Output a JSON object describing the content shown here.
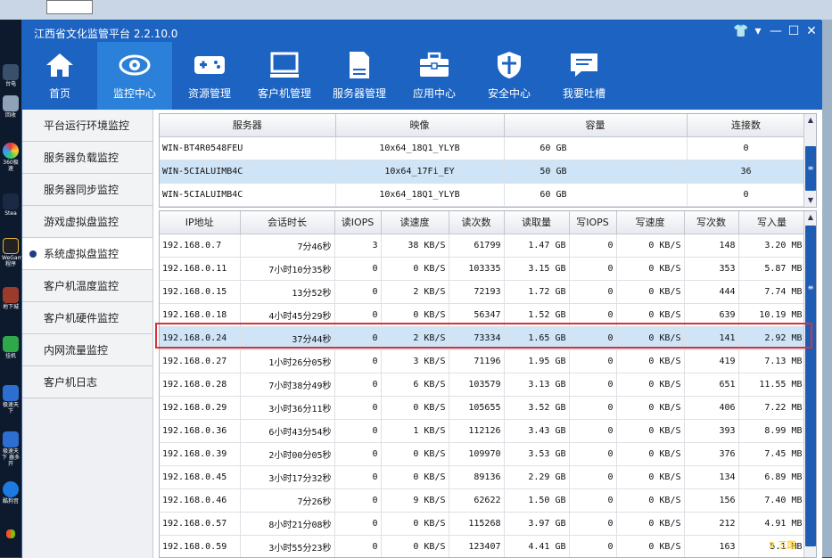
{
  "app": {
    "title": "江西省文化监管平台 2.2.10.0",
    "controls": [
      "shirt-icon",
      "menu-icon",
      "minimize-icon",
      "maximize-icon",
      "close-icon"
    ]
  },
  "nav": [
    {
      "label": "首页",
      "icon": "home-icon",
      "active": false
    },
    {
      "label": "监控中心",
      "icon": "eye-icon",
      "active": true
    },
    {
      "label": "资源管理",
      "icon": "gamepad-icon",
      "active": false
    },
    {
      "label": "客户机管理",
      "icon": "monitor-icon",
      "active": false
    },
    {
      "label": "服务器管理",
      "icon": "server-icon",
      "active": false
    },
    {
      "label": "应用中心",
      "icon": "toolbox-icon",
      "active": false
    },
    {
      "label": "安全中心",
      "icon": "shield-icon",
      "active": false
    },
    {
      "label": "我要吐槽",
      "icon": "chat-icon",
      "active": false
    }
  ],
  "sidebar": [
    {
      "label": "平台运行环境监控",
      "active": false
    },
    {
      "label": "服务器负载监控",
      "active": false
    },
    {
      "label": "服务器同步监控",
      "active": false
    },
    {
      "label": "游戏虚拟盘监控",
      "active": false
    },
    {
      "label": "系统虚拟盘监控",
      "active": true
    },
    {
      "label": "客户机温度监控",
      "active": false
    },
    {
      "label": "客户机硬件监控",
      "active": false
    },
    {
      "label": "内网流量监控",
      "active": false
    },
    {
      "label": "客户机日志",
      "active": false
    }
  ],
  "servers": {
    "headers": [
      "服务器",
      "映像",
      "容量",
      "连接数"
    ],
    "rows": [
      [
        "WIN-BT4R0548FEU",
        "10x64_18Q1_YLYB",
        "60 GB",
        "0"
      ],
      [
        "WIN-5CIALUIMB4C",
        "10x64_17Fi_EY",
        "50 GB",
        "36"
      ],
      [
        "WIN-5CIALUIMB4C",
        "10x64_18Q1_YLYB",
        "60 GB",
        "0"
      ]
    ],
    "selected_row": 1
  },
  "clients": {
    "headers": [
      "IP地址",
      "会话时长",
      "读IOPS",
      "读速度",
      "读次数",
      "读取量",
      "写IOPS",
      "写速度",
      "写次数",
      "写入量"
    ],
    "rows": [
      [
        "192.168.0.7",
        "7分46秒",
        "3",
        "38 KB/S",
        "61799",
        "1.47 GB",
        "0",
        "0 KB/S",
        "148",
        "3.20 MB"
      ],
      [
        "192.168.0.11",
        "7小时10分35秒",
        "0",
        "0 KB/S",
        "103335",
        "3.15 GB",
        "0",
        "0 KB/S",
        "353",
        "5.87 MB"
      ],
      [
        "192.168.0.15",
        "13分52秒",
        "0",
        "2 KB/S",
        "72193",
        "1.72 GB",
        "0",
        "0 KB/S",
        "444",
        "7.74 MB"
      ],
      [
        "192.168.0.18",
        "4小时45分29秒",
        "0",
        "0 KB/S",
        "56347",
        "1.52 GB",
        "0",
        "0 KB/S",
        "639",
        "10.19 MB"
      ],
      [
        "192.168.0.24",
        "37分44秒",
        "0",
        "2 KB/S",
        "73334",
        "1.65 GB",
        "0",
        "0 KB/S",
        "141",
        "2.92 MB"
      ],
      [
        "192.168.0.27",
        "1小时26分05秒",
        "0",
        "3 KB/S",
        "71196",
        "1.95 GB",
        "0",
        "0 KB/S",
        "419",
        "7.13 MB"
      ],
      [
        "192.168.0.28",
        "7小时38分49秒",
        "0",
        "6 KB/S",
        "103579",
        "3.13 GB",
        "0",
        "0 KB/S",
        "651",
        "11.55 MB"
      ],
      [
        "192.168.0.29",
        "3小时36分11秒",
        "0",
        "0 KB/S",
        "105655",
        "3.52 GB",
        "0",
        "0 KB/S",
        "406",
        "7.22 MB"
      ],
      [
        "192.168.0.36",
        "6小时43分54秒",
        "0",
        "1 KB/S",
        "112126",
        "3.43 GB",
        "0",
        "0 KB/S",
        "393",
        "8.99 MB"
      ],
      [
        "192.168.0.39",
        "2小时00分05秒",
        "0",
        "0 KB/S",
        "109970",
        "3.53 GB",
        "0",
        "0 KB/S",
        "376",
        "7.45 MB"
      ],
      [
        "192.168.0.45",
        "3小时17分32秒",
        "0",
        "0 KB/S",
        "89136",
        "2.29 GB",
        "0",
        "0 KB/S",
        "134",
        "6.89 MB"
      ],
      [
        "192.168.0.46",
        "7分26秒",
        "0",
        "9 KB/S",
        "62622",
        "1.50 GB",
        "0",
        "0 KB/S",
        "156",
        "7.40 MB"
      ],
      [
        "192.168.0.57",
        "8小时21分08秒",
        "0",
        "0 KB/S",
        "115268",
        "3.97 GB",
        "0",
        "0 KB/S",
        "212",
        "4.91 MB"
      ],
      [
        "192.168.0.59",
        "3小时55分23秒",
        "0",
        "0 KB/S",
        "123407",
        "4.41 GB",
        "0",
        "0 KB/S",
        "163",
        "5.1 MB"
      ]
    ],
    "selected_row": 4
  },
  "desktop": {
    "taskbar_labels": [
      "台电",
      "回收",
      "360极速",
      "Stea",
      "WeGam 程序",
      "地下城",
      "挂机",
      "极速天下",
      "极速天下 器多开",
      "酷狗音"
    ],
    "watermark": "2 三国"
  }
}
